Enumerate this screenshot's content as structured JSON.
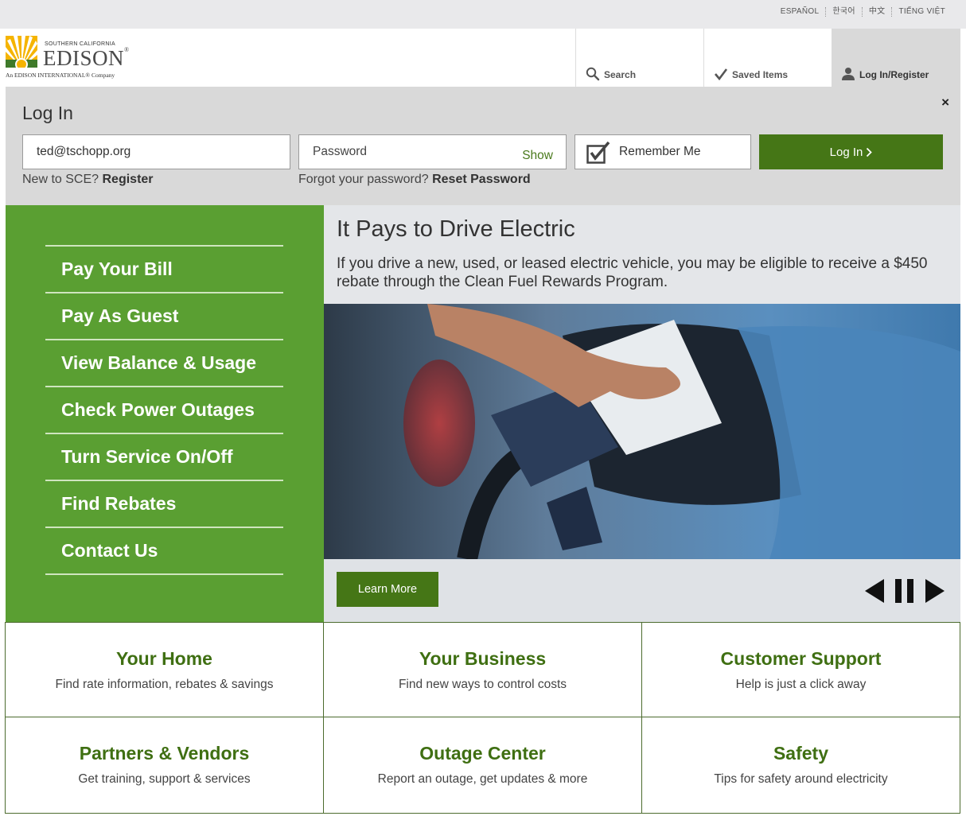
{
  "languages": [
    "ESPAÑOL",
    "한국어",
    "中文",
    "TIẾNG VIỆT"
  ],
  "logo": {
    "small_text": "SOUTHERN CALIFORNIA",
    "name": "EDISON",
    "reg": "®",
    "subtitle": "An EDISON INTERNATIONAL® Company"
  },
  "utility_nav": {
    "search": "Search",
    "saved": "Saved Items",
    "login": "Log In/Register"
  },
  "login": {
    "title": "Log In",
    "close": "×",
    "email_value": "ted@tschopp.org",
    "password_placeholder": "Password",
    "show_label": "Show",
    "remember_label": "Remember Me",
    "button_label": "Log In",
    "new_prefix": "New to SCE?",
    "register_link": "Register",
    "forgot_prefix": "Forgot your password?",
    "reset_link": "Reset Password"
  },
  "menu": [
    "Pay Your Bill",
    "Pay As Guest",
    "View Balance & Usage",
    "Check Power Outages",
    "Turn Service On/Off",
    "Find Rebates",
    "Contact Us"
  ],
  "hero": {
    "title": "It Pays to Drive Electric",
    "description": "If you drive a new, used, or leased electric vehicle, you may be eligible to receive a $450 rebate through the Clean Fuel Rewards Program.",
    "button": "Learn More"
  },
  "tiles": [
    {
      "title": "Your Home",
      "subtitle": "Find rate information, rebates & savings"
    },
    {
      "title": "Your Business",
      "subtitle": "Find new ways to control costs"
    },
    {
      "title": "Customer Support",
      "subtitle": "Help is just a click away"
    },
    {
      "title": "Partners & Vendors",
      "subtitle": "Get training, support & services"
    },
    {
      "title": "Outage Center",
      "subtitle": "Report an outage, get updates & more"
    },
    {
      "title": "Safety",
      "subtitle": "Tips for safety around electricity"
    }
  ],
  "colors": {
    "brand_green": "#457616",
    "menu_green": "#5a9f32",
    "tile_title_green": "#3f6f12",
    "panel_gray": "#d9d9d9"
  }
}
